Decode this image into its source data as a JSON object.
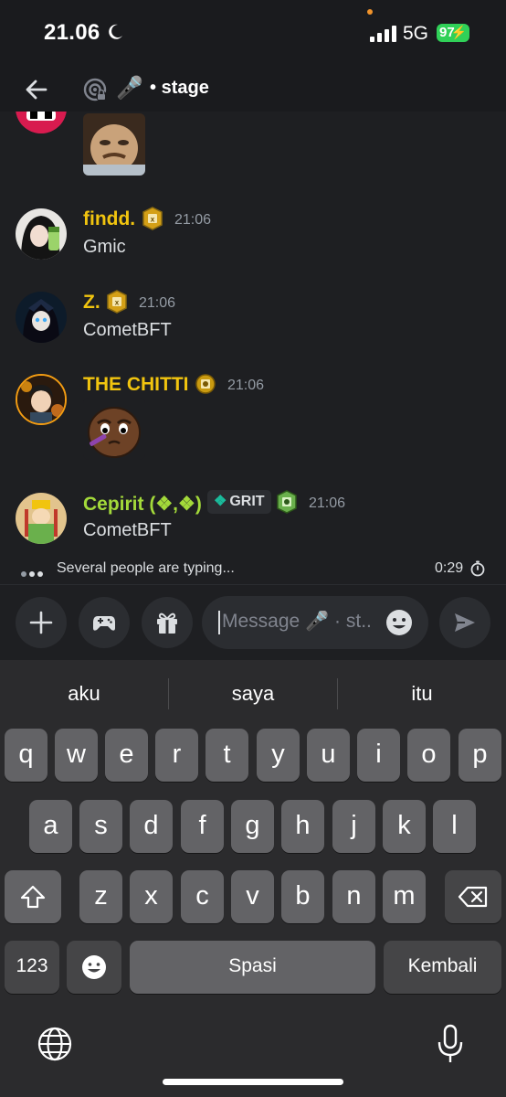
{
  "status_bar": {
    "time": "21.06",
    "network": "5G",
    "battery": "97"
  },
  "header": {
    "channel_name": "stage",
    "channel_icon": "🎤",
    "separator": "•"
  },
  "messages": [
    {
      "author": "findd.",
      "time": "21:06",
      "text": "Gmic",
      "name_color": "#f1c40f"
    },
    {
      "author": "Z.",
      "time": "21:06",
      "text": "CometBFT",
      "name_color": "#f1c40f"
    },
    {
      "author": "THE CHITTI",
      "time": "21:06",
      "text": "",
      "name_color": "#f1c40f",
      "sticker": "coffee-bean-sticker"
    },
    {
      "author": "Cepirit (❖,❖)",
      "time": "21:06",
      "text": "CometBFT",
      "name_color": "#a3d93a",
      "tag": "GRIT"
    }
  ],
  "typing": {
    "text": "Several people are typing...",
    "slowmode": "0:29"
  },
  "composer": {
    "placeholder": "Message 🎤 · st..",
    "icons": [
      "plus-icon",
      "gamepad-icon",
      "gift-icon",
      "emoji-icon",
      "send-icon"
    ]
  },
  "keyboard": {
    "suggestions": [
      "aku",
      "saya",
      "itu"
    ],
    "row1": [
      "q",
      "w",
      "e",
      "r",
      "t",
      "y",
      "u",
      "i",
      "o",
      "p"
    ],
    "row2": [
      "a",
      "s",
      "d",
      "f",
      "g",
      "h",
      "j",
      "k",
      "l"
    ],
    "row3": [
      "z",
      "x",
      "c",
      "v",
      "b",
      "n",
      "m"
    ],
    "numbers_key": "123",
    "space_key": "Spasi",
    "return_key": "Kembali"
  },
  "colors": {
    "background": "#1e1f22",
    "accent_gold": "#f1c40f",
    "accent_green": "#a3d93a",
    "battery_green": "#30d158"
  }
}
